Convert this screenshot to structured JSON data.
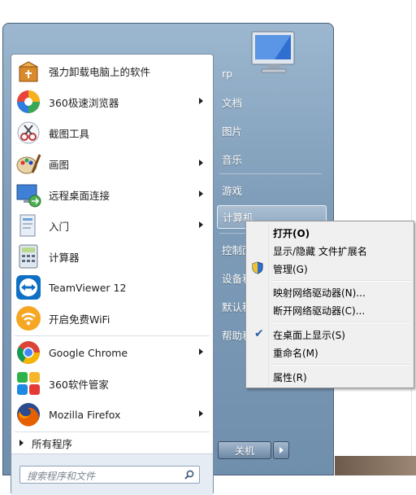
{
  "left_menu": {
    "items": [
      {
        "label": "强力卸载电脑上的软件",
        "icon": "uninstall-box-icon",
        "has_arrow": false
      },
      {
        "label": "360极速浏览器",
        "icon": "browser-360-icon",
        "has_arrow": true
      },
      {
        "label": "截图工具",
        "icon": "snipping-tool-icon",
        "has_arrow": false
      },
      {
        "label": "画图",
        "icon": "paint-icon",
        "has_arrow": true
      },
      {
        "label": "远程桌面连接",
        "icon": "remote-desktop-icon",
        "has_arrow": true
      },
      {
        "label": "入门",
        "icon": "getting-started-icon",
        "has_arrow": true
      },
      {
        "label": "计算器",
        "icon": "calculator-icon",
        "has_arrow": false
      },
      {
        "label": "TeamViewer 12",
        "icon": "teamviewer-icon",
        "has_arrow": false
      },
      {
        "label": "开启免费WiFi",
        "icon": "wifi-icon",
        "has_arrow": false
      },
      {
        "label": "Google Chrome",
        "icon": "chrome-icon",
        "has_arrow": true
      },
      {
        "label": "360软件管家",
        "icon": "software-manager-360-icon",
        "has_arrow": false
      },
      {
        "label": "Mozilla Firefox",
        "icon": "firefox-icon",
        "has_arrow": true
      }
    ],
    "all_programs": "所有程序",
    "search_placeholder": "搜索程序和文件"
  },
  "right_menu": {
    "items": [
      {
        "label": "rp"
      },
      {
        "label": "文档"
      },
      {
        "label": "图片"
      },
      {
        "label": "音乐"
      },
      {
        "label": "游戏"
      },
      {
        "label": "计算机",
        "highlighted": true
      },
      {
        "label": "控制面"
      },
      {
        "label": "设备和"
      },
      {
        "label": "默认程"
      },
      {
        "label": "帮助和"
      }
    ],
    "shutdown_label": "关机"
  },
  "context_menu": {
    "items": [
      {
        "label": "打开(O)",
        "bold": true
      },
      {
        "label": "显示/隐藏 文件扩展名"
      },
      {
        "label": "管理(G)",
        "icon": "uac-shield-icon"
      },
      {
        "label": "映射网络驱动器(N)..."
      },
      {
        "label": "断开网络驱动器(C)..."
      },
      {
        "label": "在桌面上显示(S)",
        "checked": true
      },
      {
        "label": "重命名(M)"
      },
      {
        "label": "属性(R)"
      }
    ]
  },
  "colors": {
    "menu_blue": "#7f9db9",
    "check_blue": "#2b5ea7"
  }
}
